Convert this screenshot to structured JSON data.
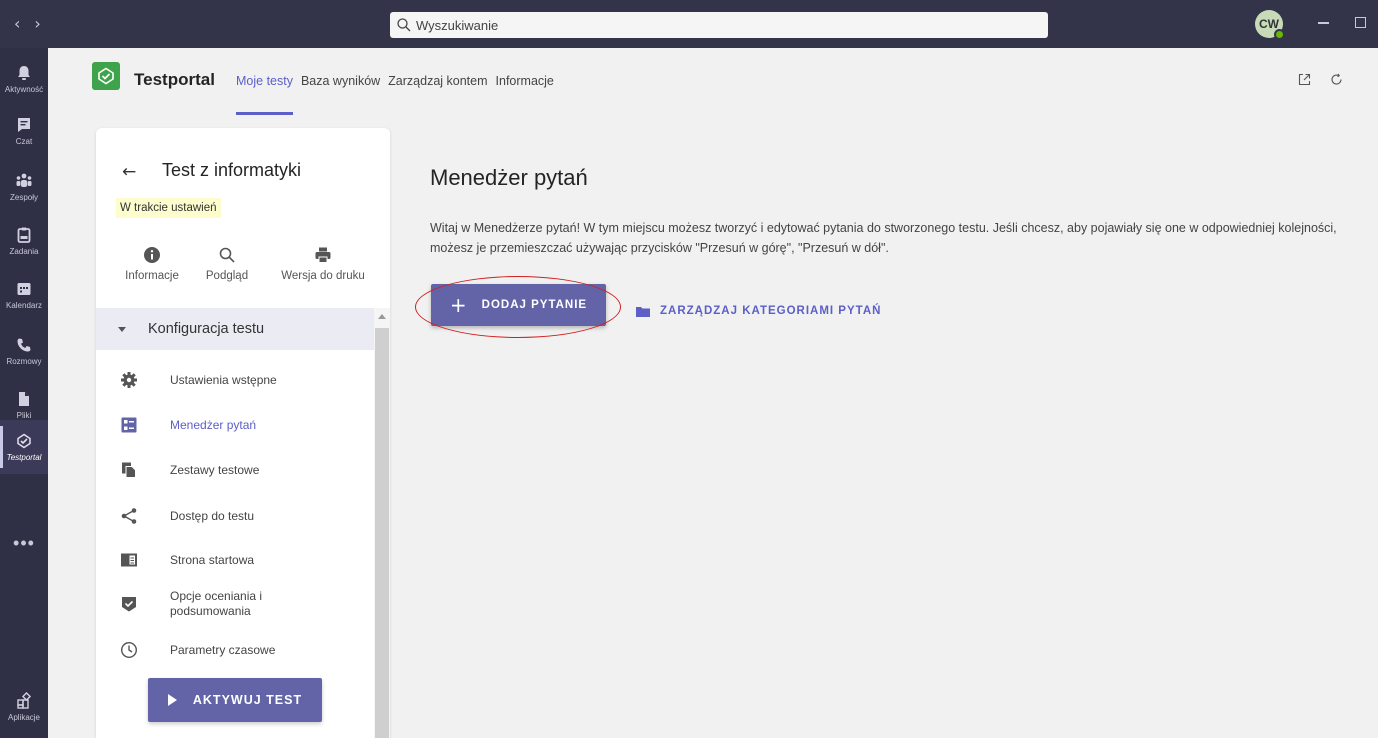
{
  "titlebar": {
    "back": "‹",
    "forward": "›",
    "search_placeholder": "Wyszukiwanie",
    "avatar_initials": "CW"
  },
  "rail": {
    "items": [
      {
        "label": "Aktywność",
        "icon": "bell-icon"
      },
      {
        "label": "Czat",
        "icon": "chat-icon"
      },
      {
        "label": "Zespoły",
        "icon": "teams-icon"
      },
      {
        "label": "Zadania",
        "icon": "assignments-icon"
      },
      {
        "label": "Kalendarz",
        "icon": "calendar-icon"
      },
      {
        "label": "Rozmowy",
        "icon": "phone-icon"
      },
      {
        "label": "Pliki",
        "icon": "file-icon"
      },
      {
        "label": "Testportal",
        "icon": "testportal-icon",
        "active": true
      },
      {
        "label": "Aplikacje",
        "icon": "apps-icon"
      }
    ],
    "more": "•••"
  },
  "app": {
    "name": "Testportal",
    "tabs": [
      "Moje testy",
      "Baza wyników",
      "Zarządzaj kontem",
      "Informacje"
    ],
    "active_tab": 0
  },
  "panel": {
    "back_arrow": "←",
    "test_title": "Test z informatyki",
    "status": "W trakcie ustawień",
    "actions": [
      "Informacje",
      "Podgląd",
      "Wersja do druku"
    ],
    "section_title": "Konfiguracja testu",
    "menu": [
      {
        "label": "Ustawienia wstępne",
        "icon": "gear-icon"
      },
      {
        "label": "Menedżer pytań",
        "icon": "question-list-icon",
        "active": true
      },
      {
        "label": "Zestawy testowe",
        "icon": "copy-icon"
      },
      {
        "label": "Dostęp do testu",
        "icon": "share-icon"
      },
      {
        "label": "Strona startowa",
        "icon": "page-icon"
      },
      {
        "label": "Opcje oceniania i podsumowania",
        "icon": "shield-check-icon"
      },
      {
        "label": "Parametry czasowe",
        "icon": "clock-icon"
      }
    ],
    "activate_label": "AKTYWUJ TEST"
  },
  "main": {
    "title": "Menedżer pytań",
    "description": "Witaj w Menedżerze pytań! W tym miejscu możesz tworzyć i edytować pytania do stworzonego testu. Jeśli chcesz, aby pojawiały się one w odpowiedniej kolejności, możesz je przemieszczać używając przycisków \"Przesuń w górę\", \"Przesuń w dół\".",
    "add_plus": "+",
    "add_label": "DODAJ PYTANIE",
    "categories_label": "ZARZĄDZAJ KATEGORIAMI PYTAŃ"
  },
  "colors": {
    "accent": "#6264a7",
    "link": "#5b5fc7",
    "rail": "#2f2f45",
    "highlight": "#d21f1f",
    "logo": "#3ea34a"
  }
}
